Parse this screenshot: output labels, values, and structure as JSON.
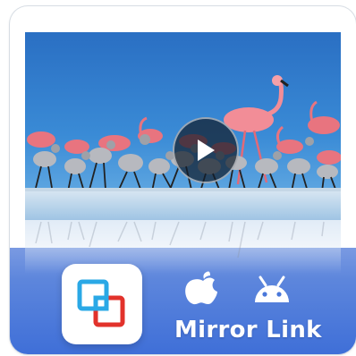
{
  "promo": {
    "app_name": "Mirror Link",
    "platform_icons": [
      "apple-icon",
      "android-icon"
    ],
    "app_icon": "mirror-link-app-icon",
    "video": {
      "subject": "flamingos-scene",
      "control_icon": "play-icon"
    }
  },
  "colors": {
    "banner_blue": "#4a78da",
    "icon_blue": "#2aa8e6",
    "icon_red": "#e2322b",
    "sky": "#2a72c4"
  }
}
